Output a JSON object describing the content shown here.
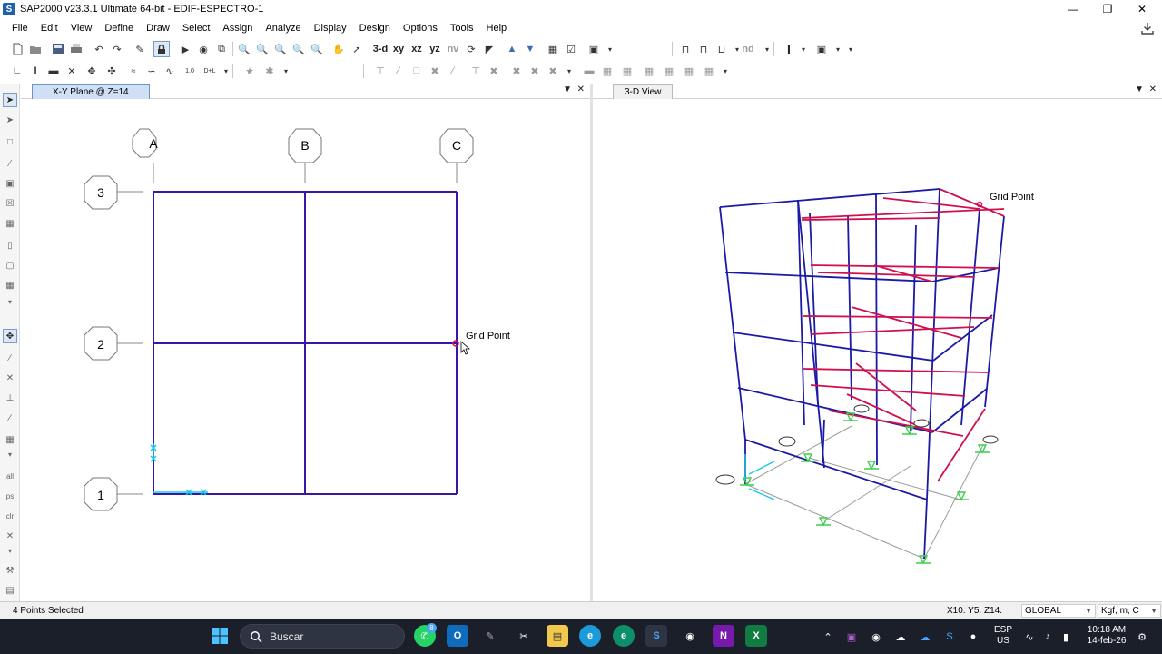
{
  "window": {
    "title": "SAP2000 v23.3.1 Ultimate 64-bit - EDIF-ESPECTRO-1",
    "logo_letter": "S"
  },
  "menu": [
    "File",
    "Edit",
    "View",
    "Define",
    "Draw",
    "Select",
    "Assign",
    "Analyze",
    "Display",
    "Design",
    "Options",
    "Tools",
    "Help"
  ],
  "toolbar": {
    "view_3d": "3-d",
    "view_xy": "xy",
    "view_xz": "xz",
    "view_yz": "yz",
    "view_nv": "nv",
    "nd": "nd",
    "section_cut": "I"
  },
  "panes": {
    "left_tab": "X-Y Plane @ Z=14",
    "right_tab": "3-D View"
  },
  "plan_view": {
    "column_labels": [
      "A",
      "B",
      "C"
    ],
    "row_labels": [
      "3",
      "2",
      "1"
    ],
    "tooltip": "Grid Point"
  },
  "view_3d": {
    "tooltip": "Grid Point"
  },
  "status": {
    "selection": "4 Points Selected",
    "coords": "X10.  Y5.  Z14.",
    "coord_system": "GLOBAL",
    "units": "Kgf, m, C"
  },
  "taskbar": {
    "search_placeholder": "Buscar",
    "lang_top": "ESP",
    "lang_bottom": "US",
    "time": "10:18 AM",
    "date": "14-feb-26",
    "whatsapp_badge": "8"
  },
  "colors": {
    "frame_blue": "#1a1aa6",
    "frame_red": "#d0104c",
    "support_green": "#3ad04a",
    "selected_cyan": "#18c8e8",
    "tab_active_bg": "#cfe0f5",
    "taskbar_bg": "#1b1f2a"
  }
}
